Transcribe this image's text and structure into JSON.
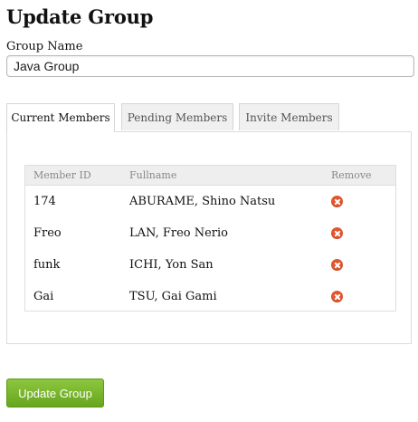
{
  "page": {
    "title": "Update Group"
  },
  "form": {
    "group_name_label": "Group Name",
    "group_name_value": "Java Group"
  },
  "tabs": [
    {
      "label": "Current Members",
      "active": true
    },
    {
      "label": "Pending Members",
      "active": false
    },
    {
      "label": "Invite Members",
      "active": false
    }
  ],
  "members_table": {
    "columns": [
      "Member ID",
      "Fullname",
      "Remove"
    ],
    "rows": [
      {
        "member_id": "174",
        "fullname": "ABURAME, Shino Natsu",
        "remove_icon": "remove-icon"
      },
      {
        "member_id": "Freo",
        "fullname": "LAN, Freo Nerio",
        "remove_icon": "remove-icon"
      },
      {
        "member_id": "funk",
        "fullname": "ICHI, Yon San",
        "remove_icon": "remove-icon"
      },
      {
        "member_id": "Gai",
        "fullname": "TSU, Gai Gami",
        "remove_icon": "remove-icon"
      }
    ]
  },
  "actions": {
    "update_label": "Update Group"
  },
  "colors": {
    "remove_icon": "#e2562f",
    "update_button": "#7cb832"
  }
}
